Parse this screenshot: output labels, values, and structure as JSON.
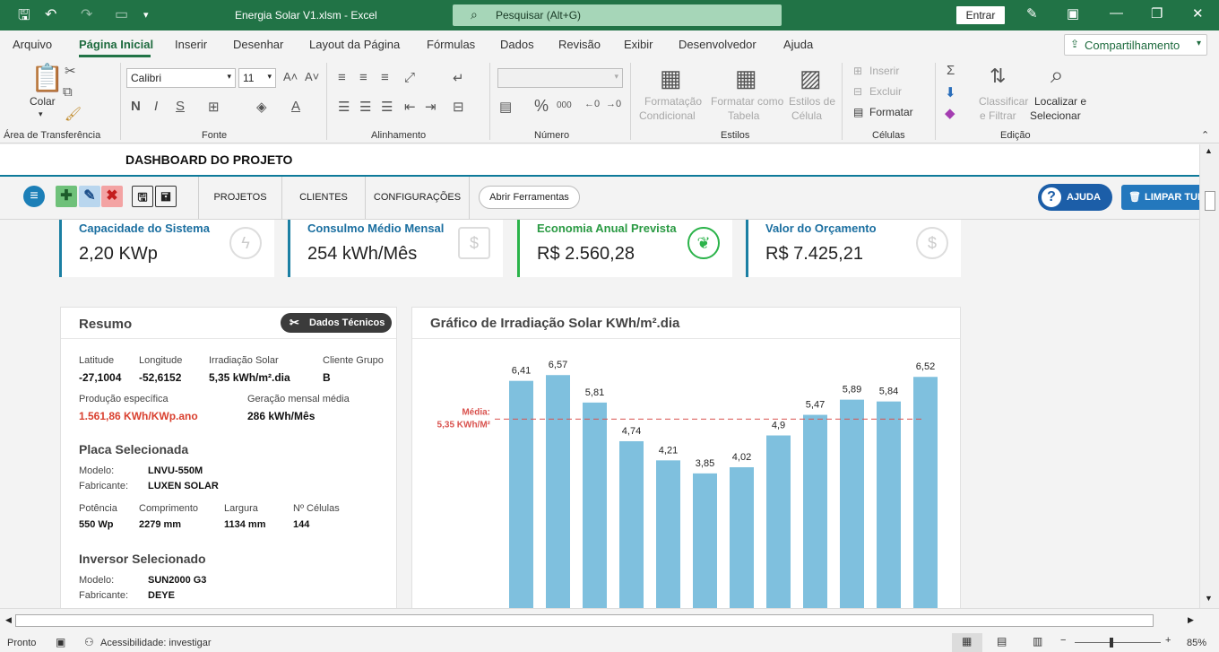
{
  "window": {
    "title": "Energia Solar V1.xlsm  -  Excel",
    "search_placeholder": "Pesquisar (Alt+G)",
    "signin_label": "Entrar"
  },
  "menu_tabs": [
    "Arquivo",
    "Página Inicial",
    "Inserir",
    "Desenhar",
    "Layout da Página",
    "Fórmulas",
    "Dados",
    "Revisão",
    "Exibir",
    "Desenvolvedor",
    "Ajuda"
  ],
  "share_label": "Compartilhamento",
  "ribbon": {
    "paste_label": "Colar",
    "font_name": "Calibri",
    "font_size": "11",
    "groups": [
      "Área de Transferência",
      "Fonte",
      "Alinhamento",
      "Número",
      "Estilos",
      "Células",
      "Edição"
    ],
    "styles": [
      "Formatação",
      "Condicional",
      "Formatar como",
      "Tabela",
      "Estilos de",
      "Célula"
    ],
    "cells": [
      "Inserir",
      "Excluir",
      "Formatar"
    ],
    "editing": [
      "Classificar",
      "e Filtrar",
      "Localizar e",
      "Selecionar"
    ],
    "font_buttons": [
      "N",
      "I",
      "S"
    ]
  },
  "dashboard": {
    "title": "DASHBOARD DO PROJETO",
    "nav_tabs": [
      "PROJETOS",
      "CLIENTES",
      "CONFIGURAÇÕES"
    ],
    "open_tools": "Abrir Ferramentas",
    "help": "AJUDA",
    "clear": "LIMPAR TUDO"
  },
  "kpis": [
    {
      "label": "Capacidade do Sistema",
      "value": "2,20 KWp",
      "icon": "lightning-icon",
      "color": "#1b7fa3"
    },
    {
      "label": "Consulmo Médio Mensal",
      "value": "254 kWh/Mês",
      "icon": "calendar-dollar-icon",
      "color": "#1b7fa3"
    },
    {
      "label": "Economia Anual Prevista",
      "value": "R$ 2.560,28",
      "icon": "leaf-icon",
      "color": "#2bb34a"
    },
    {
      "label": "Valor do Orçamento",
      "value": "R$ 7.425,21",
      "icon": "dollar-icon",
      "color": "#1b7fa3"
    }
  ],
  "resumo": {
    "title": "Resumo",
    "tech_btn": "Dados Técnicos",
    "latitude_label": "Latitude",
    "latitude": "-27,1004",
    "longitude_label": "Longitude",
    "longitude": "-52,6152",
    "irradiation_label": "Irradiação Solar",
    "irradiation": "5,35 kWh/m².dia",
    "group_label": "Cliente Grupo",
    "group": "B",
    "prod_label": "Produção específica",
    "prod": "1.561,86 KWh/KWp.ano",
    "gen_label": "Geração mensal média",
    "gen": "286 kWh/Mês",
    "panel_title": "Placa Selecionada",
    "model_label": "Modelo:",
    "panel_model": "LNVU-550M",
    "maker_label": "Fabricante:",
    "panel_maker": "LUXEN SOLAR",
    "power_label": "Potência",
    "power": "550 Wp",
    "length_label": "Comprimento",
    "length": "2279 mm",
    "width_label": "Largura",
    "width": "1134 mm",
    "cells_label": "Nº Células",
    "cells": "144",
    "inverter_title": "Inversor Selecionado",
    "inverter_model": "SUN2000 G3",
    "inverter_maker": "DEYE"
  },
  "chart_data": {
    "type": "bar",
    "title": "Gráfico de Irradiação Solar KWh/m².dia",
    "values": [
      6.41,
      6.57,
      5.81,
      4.74,
      4.21,
      3.85,
      4.02,
      4.9,
      5.47,
      5.89,
      5.84,
      6.52
    ],
    "labels": [
      "6,41",
      "6,57",
      "5,81",
      "4,74",
      "4,21",
      "3,85",
      "4,02",
      "4,9",
      "5,47",
      "5,89",
      "5,84",
      "6,52"
    ],
    "average": 5.35,
    "average_label_1": "Média:",
    "average_label_2": "5,35 KWh/M²",
    "bar_color": "#7fc0de",
    "avg_color": "#d9534f"
  },
  "status": {
    "ready": "Pronto",
    "accessibility": "Acessibilidade: investigar",
    "zoom": "85%"
  }
}
